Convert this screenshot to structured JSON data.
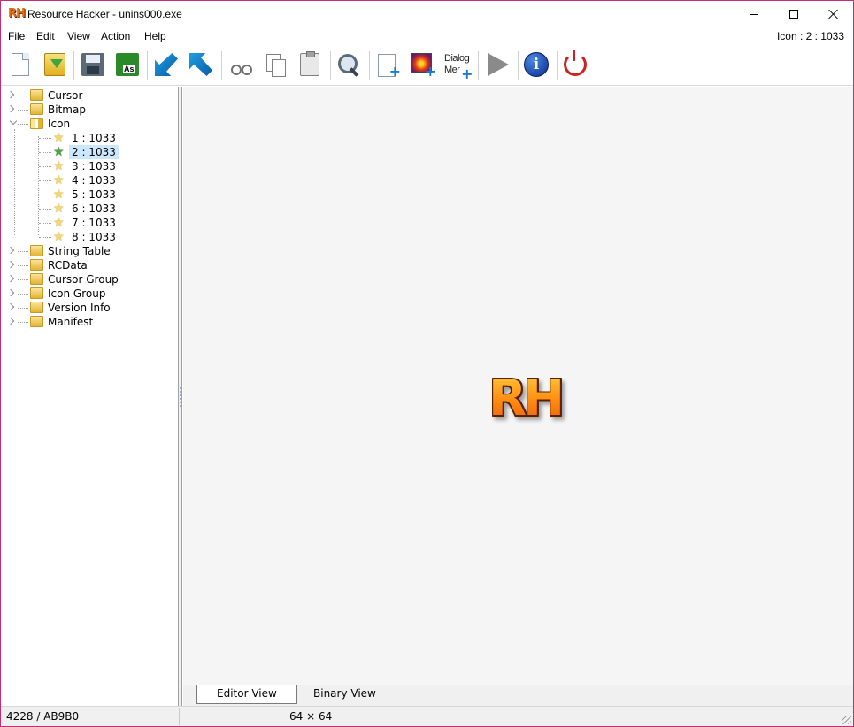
{
  "window": {
    "title": "Resource Hacker - unins000.exe",
    "app_icon_text": "RH"
  },
  "menu": {
    "items": [
      "File",
      "Edit",
      "View",
      "Action",
      "Help"
    ],
    "status": "Icon : 2 : 1033"
  },
  "toolbar": {
    "buttons": [
      {
        "icon": "new-file-icon"
      },
      {
        "icon": "open-file-icon"
      },
      {
        "icon": "save-icon"
      },
      {
        "icon": "save-as-icon",
        "label": "As"
      },
      {
        "icon": "back-arrow-icon"
      },
      {
        "icon": "forward-arrow-icon"
      },
      {
        "icon": "cut-icon"
      },
      {
        "icon": "copy-icon"
      },
      {
        "icon": "paste-icon"
      },
      {
        "icon": "find-icon"
      },
      {
        "icon": "add-blank-resource-icon"
      },
      {
        "icon": "add-image-resource-icon"
      },
      {
        "icon": "dialog-merger-icon",
        "label_line1": "Dialog",
        "label_line2": "Mer"
      },
      {
        "icon": "compile-run-icon"
      },
      {
        "icon": "info-icon"
      },
      {
        "icon": "exit-power-icon"
      }
    ]
  },
  "tree": {
    "nodes": [
      {
        "label": "Cursor",
        "expanded": false
      },
      {
        "label": "Bitmap",
        "expanded": false
      },
      {
        "label": "Icon",
        "expanded": true,
        "children": [
          {
            "label": "1 : 1033"
          },
          {
            "label": "2 : 1033",
            "selected": true
          },
          {
            "label": "3 : 1033"
          },
          {
            "label": "4 : 1033"
          },
          {
            "label": "5 : 1033"
          },
          {
            "label": "6 : 1033"
          },
          {
            "label": "7 : 1033"
          },
          {
            "label": "8 : 1033"
          }
        ]
      },
      {
        "label": "String Table",
        "expanded": false
      },
      {
        "label": "RCData",
        "expanded": false
      },
      {
        "label": "Cursor Group",
        "expanded": false
      },
      {
        "label": "Icon Group",
        "expanded": false
      },
      {
        "label": "Version Info",
        "expanded": false
      },
      {
        "label": "Manifest",
        "expanded": false
      }
    ]
  },
  "editor": {
    "preview_text": "RH",
    "tabs": [
      {
        "label": "Editor View",
        "active": true
      },
      {
        "label": "Binary View",
        "active": false
      }
    ]
  },
  "statusbar": {
    "offset": "4228 / AB9B0",
    "dimensions": "64 × 64"
  },
  "colors": {
    "selection": "#cce8ff",
    "logo_orange": "#f39a20",
    "window_border": "#c03070"
  }
}
